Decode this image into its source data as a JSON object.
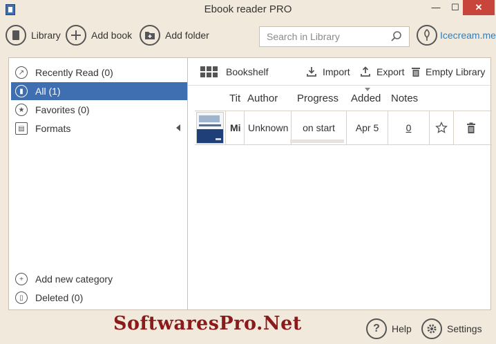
{
  "window": {
    "title": "Ebook reader PRO",
    "minimize_glyph": "—",
    "maximize_glyph": "☐",
    "close_glyph": "✕"
  },
  "toolbar": {
    "library_label": "Library",
    "add_book_label": "Add book",
    "add_folder_label": "Add folder",
    "search_placeholder": "Search in Library",
    "brand_label": "Icecream.me"
  },
  "sidebar": {
    "items": [
      {
        "label": "Recently Read (0)",
        "icon": "share-icon"
      },
      {
        "label": "All (1)",
        "icon": "book-icon",
        "selected": true
      },
      {
        "label": "Favorites (0)",
        "icon": "star-icon"
      },
      {
        "label": "Formats",
        "icon": "document-icon"
      }
    ],
    "add_category_label": "Add new category",
    "deleted_label": "Deleted (0)"
  },
  "content": {
    "view_label": "Bookshelf",
    "import_label": "Import",
    "export_label": "Export",
    "empty_label": "Empty Library",
    "columns": [
      "Tit",
      "Author",
      "Progress",
      "Added",
      "Notes"
    ],
    "rows": [
      {
        "title": "Mi",
        "author": "Unknown",
        "progress": "on start",
        "progress_fraction": 1.0,
        "added": "Apr 5",
        "notes": "0"
      }
    ]
  },
  "footer": {
    "watermark": "SoftwaresPro.Net",
    "help_label": "Help",
    "settings_label": "Settings"
  },
  "colors": {
    "accent": "#3f6fb0",
    "brand_link": "#2e7fc0",
    "close_button": "#c7453b",
    "background": "#f1e9dc",
    "watermark": "#8b1a1a"
  }
}
